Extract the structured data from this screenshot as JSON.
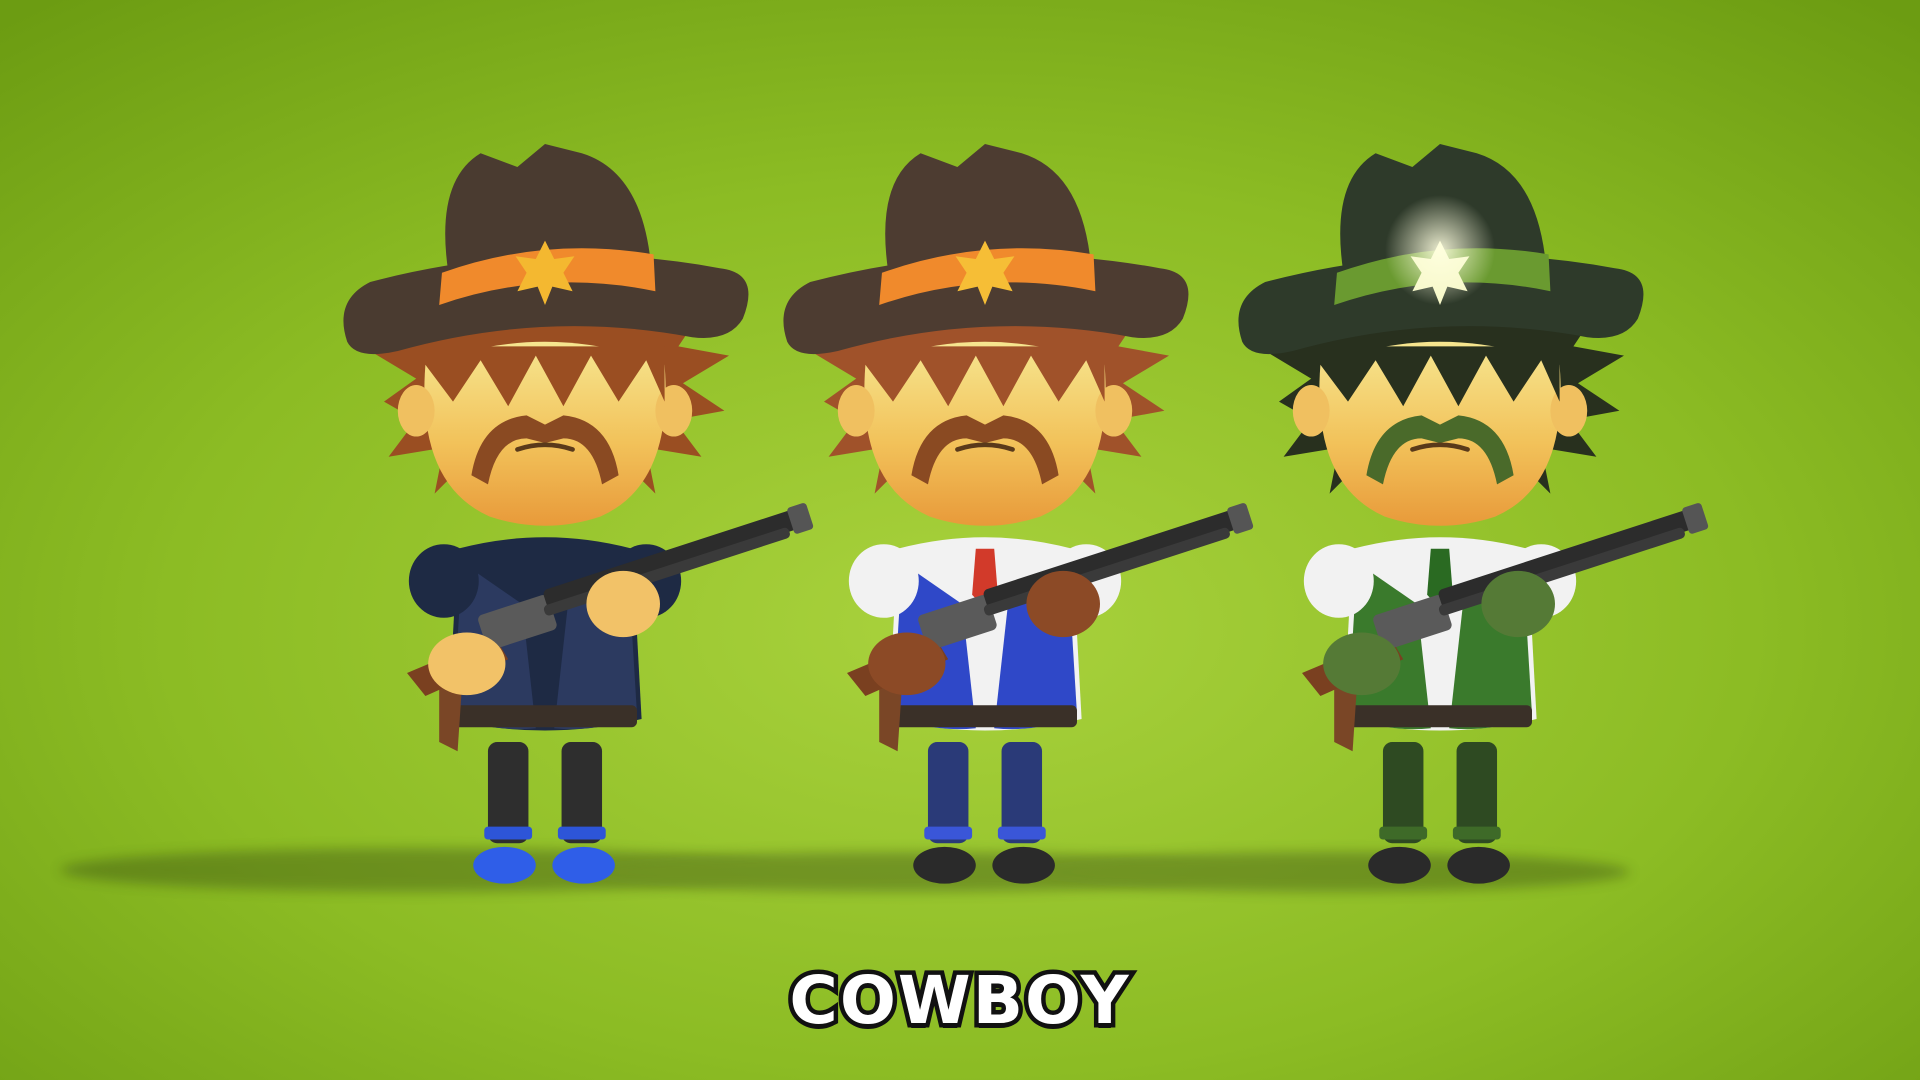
{
  "scene": {
    "caption": "COWBOY",
    "background": {
      "center": "#a9d23d",
      "mid": "#8cbc24",
      "edge": "#6c9c12"
    },
    "characters": [
      {
        "id": "cowboy-blue-black",
        "hat": "#4a3b30",
        "hat_band": "#f08a2c",
        "badge": "#f4b830",
        "hair": "#9a4e22",
        "mustache": "#8a4a22",
        "shirt": "#1e2a44",
        "vest": "#2c3a60",
        "pants": "#2e2e2e",
        "trim": "#2d55d8",
        "gloves": "#f2c268",
        "shoes": "#2f5ee8"
      },
      {
        "id": "cowboy-blue-vest",
        "hat": "#4d3c31",
        "hat_band": "#f08a2c",
        "badge": "#f6be36",
        "hair": "#a0522a",
        "mustache": "#8a4a22",
        "shirt": "#f2f2f2",
        "vest": "#2f48c8",
        "tie": "#d23a2a",
        "pants": "#2a3a78",
        "trim": "#3a56d8",
        "gloves": "#8c4a26",
        "shoes": "#2a2a2a"
      },
      {
        "id": "cowboy-green",
        "hat": "#2e3a2a",
        "hat_band": "#6a9a30",
        "badge": "#f6f8c8",
        "hair": "#28301e",
        "mustache": "#4a6a2a",
        "shirt": "#f2f2f2",
        "vest": "#3a7a2c",
        "tie": "#2a6a22",
        "pants": "#2e4a22",
        "trim": "#3e6a28",
        "gloves": "#557a36",
        "shoes": "#2a2a2a"
      }
    ]
  }
}
